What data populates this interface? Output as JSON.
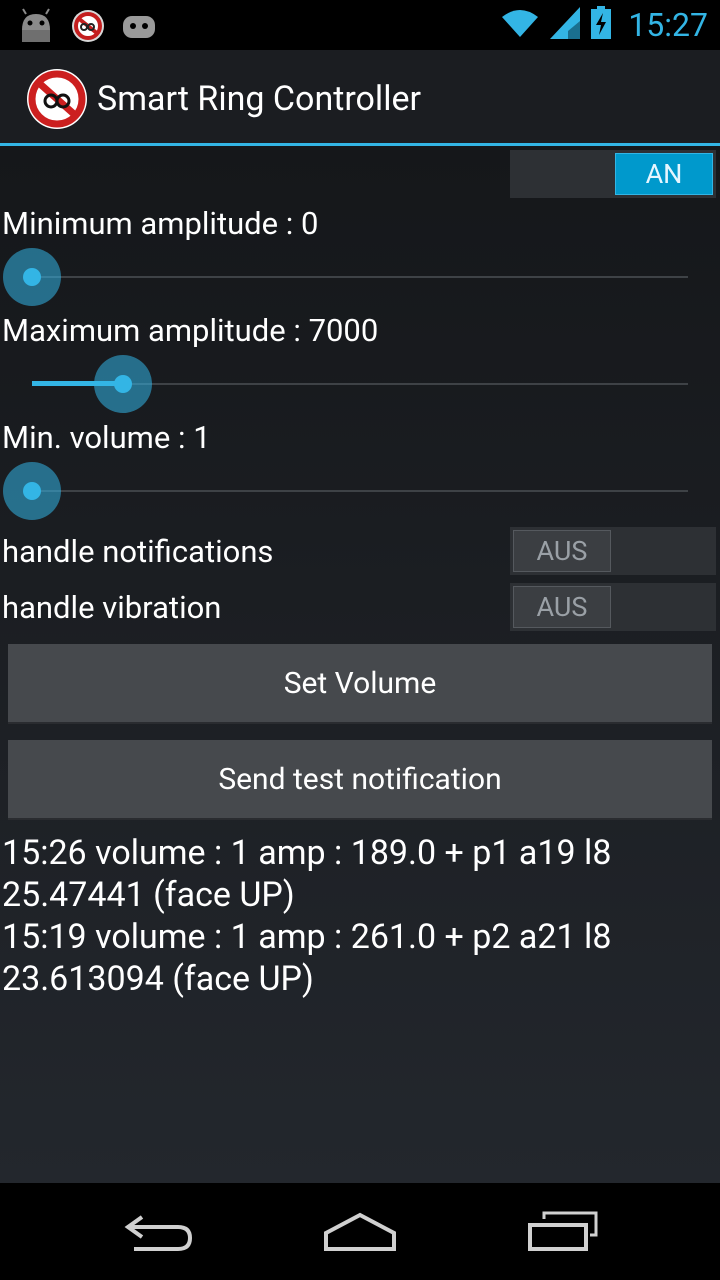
{
  "status_bar": {
    "time": "15:27",
    "icons_left": [
      "android-icon",
      "app-notification-icon",
      "android-bug-icon"
    ],
    "icons_right": [
      "wifi-icon",
      "signal-icon",
      "battery-charging-icon"
    ]
  },
  "action_bar": {
    "title": "Smart Ring Controller",
    "icon": "app-no-ring-icon"
  },
  "master_switch": {
    "label": "AN",
    "state": "on"
  },
  "sliders": {
    "min_amplitude": {
      "label": "Minimum amplitude : 0",
      "value": 0
    },
    "max_amplitude": {
      "label": "Maximum amplitude : 7000",
      "value": 7000
    },
    "min_volume": {
      "label": "Min. volume : 1",
      "value": 1
    }
  },
  "toggles": {
    "notifications": {
      "label": "handle notifications",
      "switch_text": "AUS",
      "state": "off"
    },
    "vibration": {
      "label": "handle vibration",
      "switch_text": "AUS",
      "state": "off"
    }
  },
  "buttons": {
    "set_volume": "Set Volume",
    "send_test": "Send test notification"
  },
  "log": [
    "15:26 volume : 1 amp : 189.0 + p1 a19 l8 25.47441 (face UP)",
    "15:19 volume : 1 amp : 261.0 + p2 a21 l8 23.613094 (face UP)"
  ],
  "colors": {
    "accent": "#33b5e5",
    "switch_on": "#0099cc",
    "button_bg": "#46494d"
  }
}
